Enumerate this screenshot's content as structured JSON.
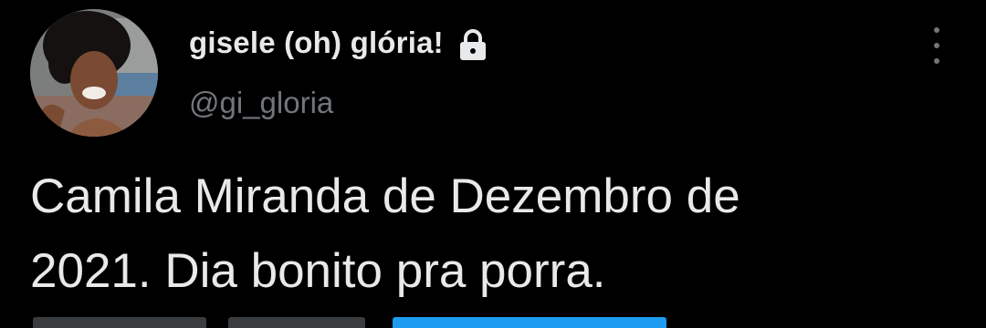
{
  "user": {
    "display_name": "gisele (oh) glória!",
    "handle": "@gi_gloria",
    "protected_icon": "lock-icon",
    "avatar_icon": "profile-photo"
  },
  "menu": {
    "icon": "more-vertical-icon"
  },
  "tweet": {
    "text": "Camila Miranda de Dezembro de\n2021. Dia bonito pra porra."
  },
  "colors": {
    "background": "#000000",
    "primary_text": "#e7e9ea",
    "secondary_text": "#71767b",
    "link": "#1d9bf0"
  }
}
